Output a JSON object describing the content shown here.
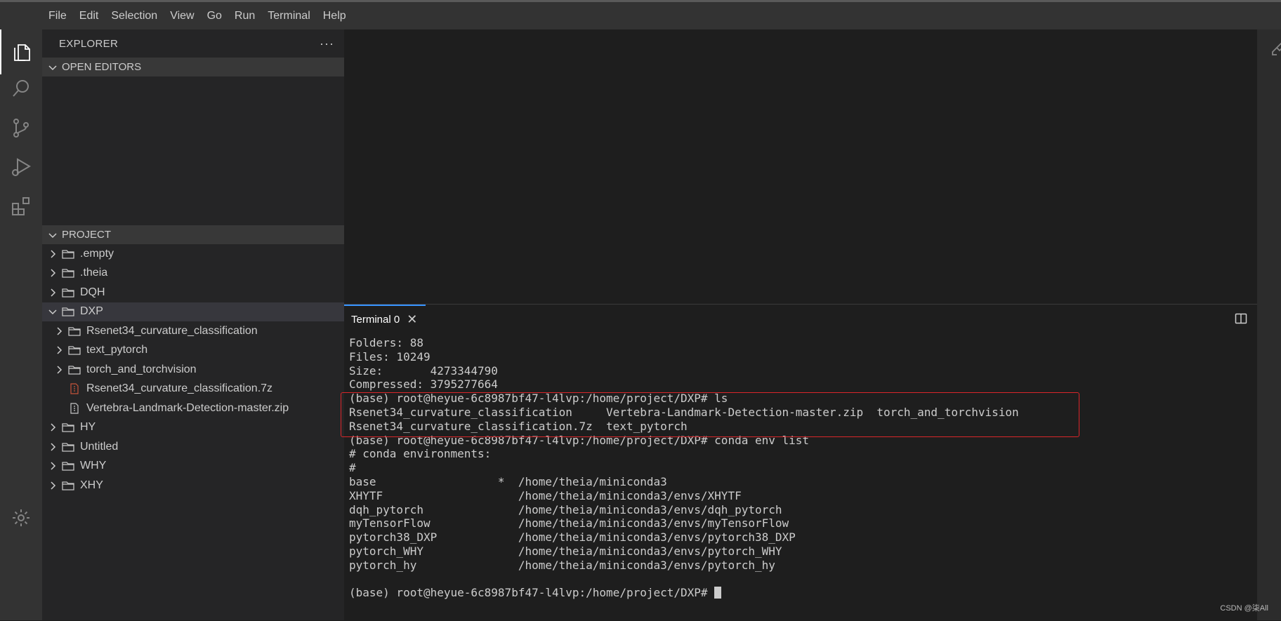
{
  "menubar": {
    "items": [
      "File",
      "Edit",
      "Selection",
      "View",
      "Go",
      "Run",
      "Terminal",
      "Help"
    ]
  },
  "activitybar": {
    "icons": [
      "explorer-icon",
      "search-icon",
      "source-control-icon",
      "run-debug-icon",
      "extensions-icon",
      "settings-gear-icon"
    ]
  },
  "sidebar": {
    "title": "EXPLORER",
    "more": "···",
    "open_editors": "OPEN EDITORS",
    "project": "PROJECT",
    "tree": [
      {
        "label": ".empty",
        "type": "folder",
        "depth": 0,
        "expanded": false
      },
      {
        "label": ".theia",
        "type": "folder",
        "depth": 0,
        "expanded": false
      },
      {
        "label": "DQH",
        "type": "folder",
        "depth": 0,
        "expanded": false
      },
      {
        "label": "DXP",
        "type": "folder",
        "depth": 0,
        "expanded": true,
        "selected": true
      },
      {
        "label": "Rsenet34_curvature_classification",
        "type": "folder",
        "depth": 1,
        "expanded": false
      },
      {
        "label": "text_pytorch",
        "type": "folder",
        "depth": 1,
        "expanded": false
      },
      {
        "label": "torch_and_torchvision",
        "type": "folder",
        "depth": 1,
        "expanded": false
      },
      {
        "label": "Rsenet34_curvature_classification.7z",
        "type": "file-7z",
        "depth": 1
      },
      {
        "label": "Vertebra-Landmark-Detection-master.zip",
        "type": "file-zip",
        "depth": 1
      },
      {
        "label": "HY",
        "type": "folder",
        "depth": 0,
        "expanded": false
      },
      {
        "label": "Untitled",
        "type": "folder",
        "depth": 0,
        "expanded": false
      },
      {
        "label": "WHY",
        "type": "folder",
        "depth": 0,
        "expanded": false
      },
      {
        "label": "XHY",
        "type": "folder",
        "depth": 0,
        "expanded": false
      }
    ]
  },
  "panel": {
    "tab_label": "Terminal 0",
    "close": "✕"
  },
  "terminal": {
    "lines": [
      "Folders: 88",
      "Files: 10249",
      "Size:       4273344790",
      "Compressed: 3795277664",
      "(base) root@heyue-6c8987bf47-l4lvp:/home/project/DXP# ls",
      "Rsenet34_curvature_classification     Vertebra-Landmark-Detection-master.zip  torch_and_torchvision",
      "Rsenet34_curvature_classification.7z  text_pytorch",
      "(base) root@heyue-6c8987bf47-l4lvp:/home/project/DXP# conda env list",
      "# conda environments:",
      "#",
      "base                  *  /home/theia/miniconda3",
      "XHYTF                    /home/theia/miniconda3/envs/XHYTF",
      "dqh_pytorch              /home/theia/miniconda3/envs/dqh_pytorch",
      "myTensorFlow             /home/theia/miniconda3/envs/myTensorFlow",
      "pytorch38_DXP            /home/theia/miniconda3/envs/pytorch38_DXP",
      "pytorch_WHY              /home/theia/miniconda3/envs/pytorch_WHY",
      "pytorch_hy               /home/theia/miniconda3/envs/pytorch_hy",
      ""
    ],
    "prompt": "(base) root@heyue-6c8987bf47-l4lvp:/home/project/DXP# "
  },
  "watermark": "CSDN @柒All",
  "colors": {
    "highlight_box": "#d9262a",
    "active_tab_border": "#3794ff",
    "file_7z": "#c5533a"
  }
}
